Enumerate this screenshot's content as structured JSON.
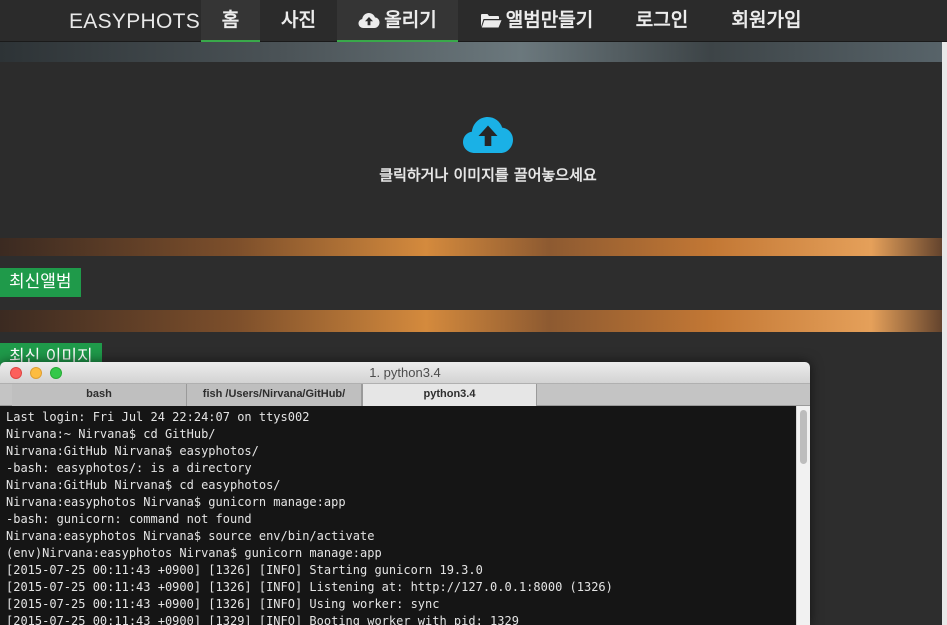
{
  "navbar": {
    "brand": "EASYPHOTS",
    "items": [
      {
        "label": "홈",
        "icon": null
      },
      {
        "label": "사진",
        "icon": null
      },
      {
        "label": "올리기",
        "icon": "cloud-upload-icon"
      },
      {
        "label": "앨범만들기",
        "icon": "folder-open-icon"
      },
      {
        "label": "로그인",
        "icon": null
      },
      {
        "label": "회원가입",
        "icon": null
      }
    ]
  },
  "upload": {
    "icon": "cloud-upload-icon",
    "text": "클릭하거나 이미지를 끌어놓으세요"
  },
  "sections": {
    "albums_label": "최신앨범",
    "images_label": "최신 이미지"
  },
  "terminal": {
    "title": "1. python3.4",
    "tabs": [
      {
        "label": "bash"
      },
      {
        "label": "fish  /Users/Nirvana/GitHub/"
      },
      {
        "label": "python3.4"
      }
    ],
    "lines": [
      "Last login: Fri Jul 24 22:24:07 on ttys002",
      "Nirvana:~ Nirvana$ cd GitHub/",
      "Nirvana:GitHub Nirvana$ easyphotos/",
      "-bash: easyphotos/: is a directory",
      "Nirvana:GitHub Nirvana$ cd easyphotos/",
      "Nirvana:easyphotos Nirvana$ gunicorn manage:app",
      "-bash: gunicorn: command not found",
      "Nirvana:easyphotos Nirvana$ source env/bin/activate",
      "(env)Nirvana:easyphotos Nirvana$ gunicorn manage:app",
      "[2015-07-25 00:11:43 +0900] [1326] [INFO] Starting gunicorn 19.3.0",
      "[2015-07-25 00:11:43 +0900] [1326] [INFO] Listening at: http://127.0.0.1:8000 (1326)",
      "[2015-07-25 00:11:43 +0900] [1326] [INFO] Using worker: sync",
      "[2015-07-25 00:11:43 +0900] [1329] [INFO] Booting worker with pid: 1329"
    ]
  },
  "colors": {
    "accent_green": "#1f9a4a",
    "upload_icon": "#1ab1e6",
    "nav_bg": "#2b2b2b"
  }
}
